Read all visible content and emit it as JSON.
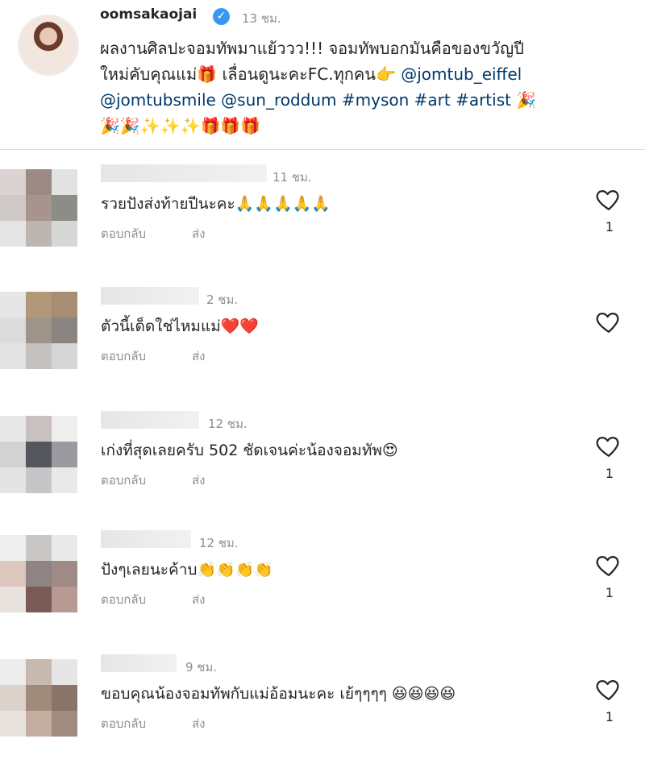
{
  "post": {
    "username": "oomsakaojai",
    "time": "13 ชม.",
    "caption": {
      "line1": "ผลงานศิลปะจอมทัพมาแย้ววว!!! จอมทัพบอกมันคือของขวัญปี",
      "line2_text": "ใหม่คับคุณแม่🎁 เลื่อนดูนะคะFC.ทุกคน👉 ",
      "line2_tag": "@jomtub_eiffel",
      "line3_tags": "@jomtubsmile @sun_roddum #myson #art #artist",
      "line3_emoji": " 🎉",
      "line4": "🎉🎉✨✨✨🎁🎁🎁"
    }
  },
  "comments": [
    {
      "time": "11 ชม.",
      "text": "รวยปังส่งท้ายปีนะคะ🙏🙏🙏🙏🙏",
      "likes": "1",
      "reply": "ตอบกลับ",
      "send": "ส่ง",
      "avatar": [
        "#d9d3d1",
        "#9c8a85",
        "#e2e2e2",
        "#cfc9c7",
        "#a7948e",
        "#8d8d87",
        "#e5e5e5",
        "#bdb5b2",
        "#d5d8d5"
      ]
    },
    {
      "time": "2 ชม.",
      "text": "ตัวนี้เด็ดใช่ไหมแม่❤️❤️",
      "likes": "",
      "reply": "ตอบกลับ",
      "send": "ส่ง",
      "avatar": [
        "#e6e6e6",
        "#b19879",
        "#a78d74",
        "#dcdcdc",
        "#9e958a",
        "#8a8580",
        "#e3e3e3",
        "#c4c2c0",
        "#d6d6d6"
      ]
    },
    {
      "time": "12 ชม.",
      "text": "เก่งที่สุดเลยครับ 502 ชัดเจนค่ะน้องจอมทัพ😍",
      "likes": "1",
      "reply": "ตอบกลับ",
      "send": "ส่ง",
      "avatar": [
        "#e8e8e8",
        "#c9c1c0",
        "#eeeeee",
        "#d2d2d2",
        "#55555c",
        "#9a9aa0",
        "#e4e4e4",
        "#c6c6c9",
        "#e9e9e9"
      ]
    },
    {
      "time": "12 ชม.",
      "text": "ปังๆเลยนะค้าบ👏👏👏👏",
      "likes": "1",
      "reply": "ตอบกลับ",
      "send": "ส่ง",
      "avatar": [
        "#eeeeee",
        "#c9c6c6",
        "#e9e9e9",
        "#dcc6bd",
        "#8f8384",
        "#a08a86",
        "#e8e2df",
        "#7a5a56",
        "#b89994"
      ]
    },
    {
      "time": "9 ชม.",
      "text": "ขอบคุณน้องจอมทัพกับแม่อ้อมนะคะ เย้ๆๆๆๆ 😆😆😆😆",
      "likes": "1",
      "reply": "ตอบกลับ",
      "send": "ส่ง",
      "avatar": [
        "#ececec",
        "#c7b9b0",
        "#e6e6e6",
        "#dcd2cc",
        "#a08a79",
        "#8a7467",
        "#e9e3df",
        "#c3aea1",
        "#a08c80"
      ]
    }
  ],
  "colors": {
    "tag": "#00376b",
    "muted": "#8e8e8e",
    "verified": "#3897f0"
  }
}
